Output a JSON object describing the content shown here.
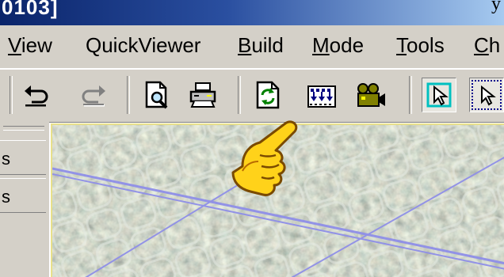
{
  "window": {
    "title_fragment": "0103]",
    "right_fragment": "y"
  },
  "menu": {
    "items": [
      {
        "label": "View",
        "mnemonic_index": 0
      },
      {
        "label": "QuickViewer",
        "mnemonic_index": -1
      },
      {
        "label": "Build",
        "mnemonic_index": 0
      },
      {
        "label": "Mode",
        "mnemonic_index": 0
      },
      {
        "label": "Tools",
        "mnemonic_index": 0
      },
      {
        "label": "Ch",
        "mnemonic_index": 0
      }
    ]
  },
  "toolbar": {
    "buttons": [
      {
        "name": "undo-button",
        "icon": "undo-icon",
        "enabled": true
      },
      {
        "name": "redo-button",
        "icon": "redo-icon",
        "enabled": false
      },
      {
        "name": "print-preview-button",
        "icon": "print-preview-icon",
        "enabled": true
      },
      {
        "name": "print-button",
        "icon": "printer-icon",
        "enabled": true
      },
      {
        "name": "refresh-button",
        "icon": "refresh-icon",
        "enabled": true
      },
      {
        "name": "build-grid-button",
        "icon": "grid-build-icon",
        "enabled": true
      },
      {
        "name": "camera-button",
        "icon": "video-camera-icon",
        "enabled": true
      },
      {
        "name": "select-tool-button",
        "icon": "select-arrow-icon",
        "pressed": true
      },
      {
        "name": "select-region-button",
        "icon": "select-region-icon",
        "pressed": true
      }
    ]
  },
  "left_panel": {
    "rows": [
      "s",
      "s"
    ]
  },
  "map": {
    "description_label": "aerial-photo-map",
    "line_color": "#8f8fe8",
    "border_color": "#e8e08a"
  },
  "colors": {
    "chrome": "#d4d0c8",
    "title_start": "#0a246a",
    "title_end": "#a6caf0"
  }
}
